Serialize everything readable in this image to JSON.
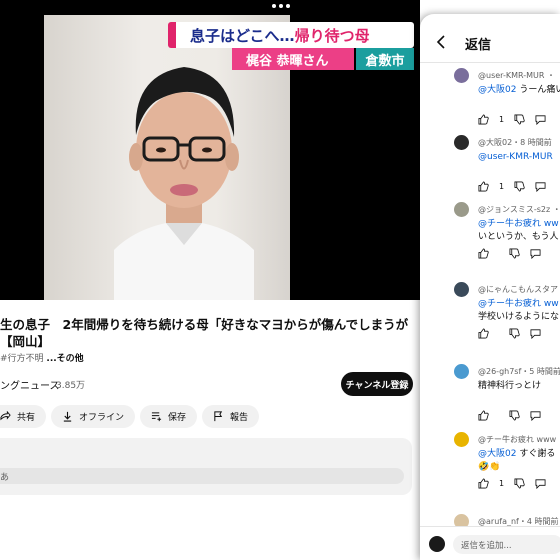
{
  "video": {
    "caption_main_blue": "息子はどこへ…",
    "caption_main_red": "帰り待つ母",
    "caption_name": "梶谷 恭暉さん",
    "caption_place": "倉敷市"
  },
  "title": {
    "line1": "生の息子　2年間帰りを待ち続ける母「好きなマヨからが傷んでしまうが　早",
    "line2": "【岡山】"
  },
  "meta": {
    "tag": "#行方不明",
    "more": "...その他"
  },
  "channel": {
    "name": "ングニュース",
    "subscribers": "3.85万",
    "subscribe_label": "チャンネル登録"
  },
  "actions": [
    {
      "icon": "share-icon",
      "label": "共有"
    },
    {
      "icon": "download-icon",
      "label": "オフライン"
    },
    {
      "icon": "save-icon",
      "label": "保存"
    },
    {
      "icon": "report-icon",
      "label": "報告"
    }
  ],
  "comments_box": {
    "preview": "あ"
  },
  "panel": {
    "title": "返信",
    "comments": [
      {
        "author": "@user-KMR-MUR ・",
        "mention": "@大阪02",
        "text": " うーん痛い",
        "line2": "",
        "likes": "1",
        "avatar_color": "#7a6e9c"
      },
      {
        "author": "@大阪02・8 時間前",
        "mention": "@user-KMR-MUR",
        "text": "",
        "line2": "",
        "likes": "1",
        "avatar_color": "#2a2a2a"
      },
      {
        "author": "@ジョンスミス-s2z ・",
        "mention": "@チー牛お疲れ ww",
        "text": "",
        "line2": "いというか、もう人",
        "likes": "",
        "avatar_color": "#9a9a8a"
      },
      {
        "author": "@にゃんこもんスタア",
        "mention": "@チー牛お疲れ ww",
        "text": "",
        "line2": "学校いけるようにな",
        "likes": "",
        "avatar_color": "#3a4a5a"
      },
      {
        "author": "@26-gh7sf・5 時間前",
        "mention": "",
        "text": "精神科行っとけ",
        "line2": "",
        "likes": "",
        "avatar_color": "#4a9ad0"
      },
      {
        "author": "@チー牛お疲れ www ・",
        "mention": "@大阪02",
        "text": " すぐ謝る",
        "line2": "🤣👏",
        "likes": "1",
        "avatar_color": "#e8b400"
      },
      {
        "author": "@arufa_nf・4 時間前",
        "mention": "",
        "text": "",
        "line2": "",
        "likes": "",
        "avatar_color": "#d9c3a0"
      }
    ],
    "reply_placeholder": "返信を追加..."
  }
}
